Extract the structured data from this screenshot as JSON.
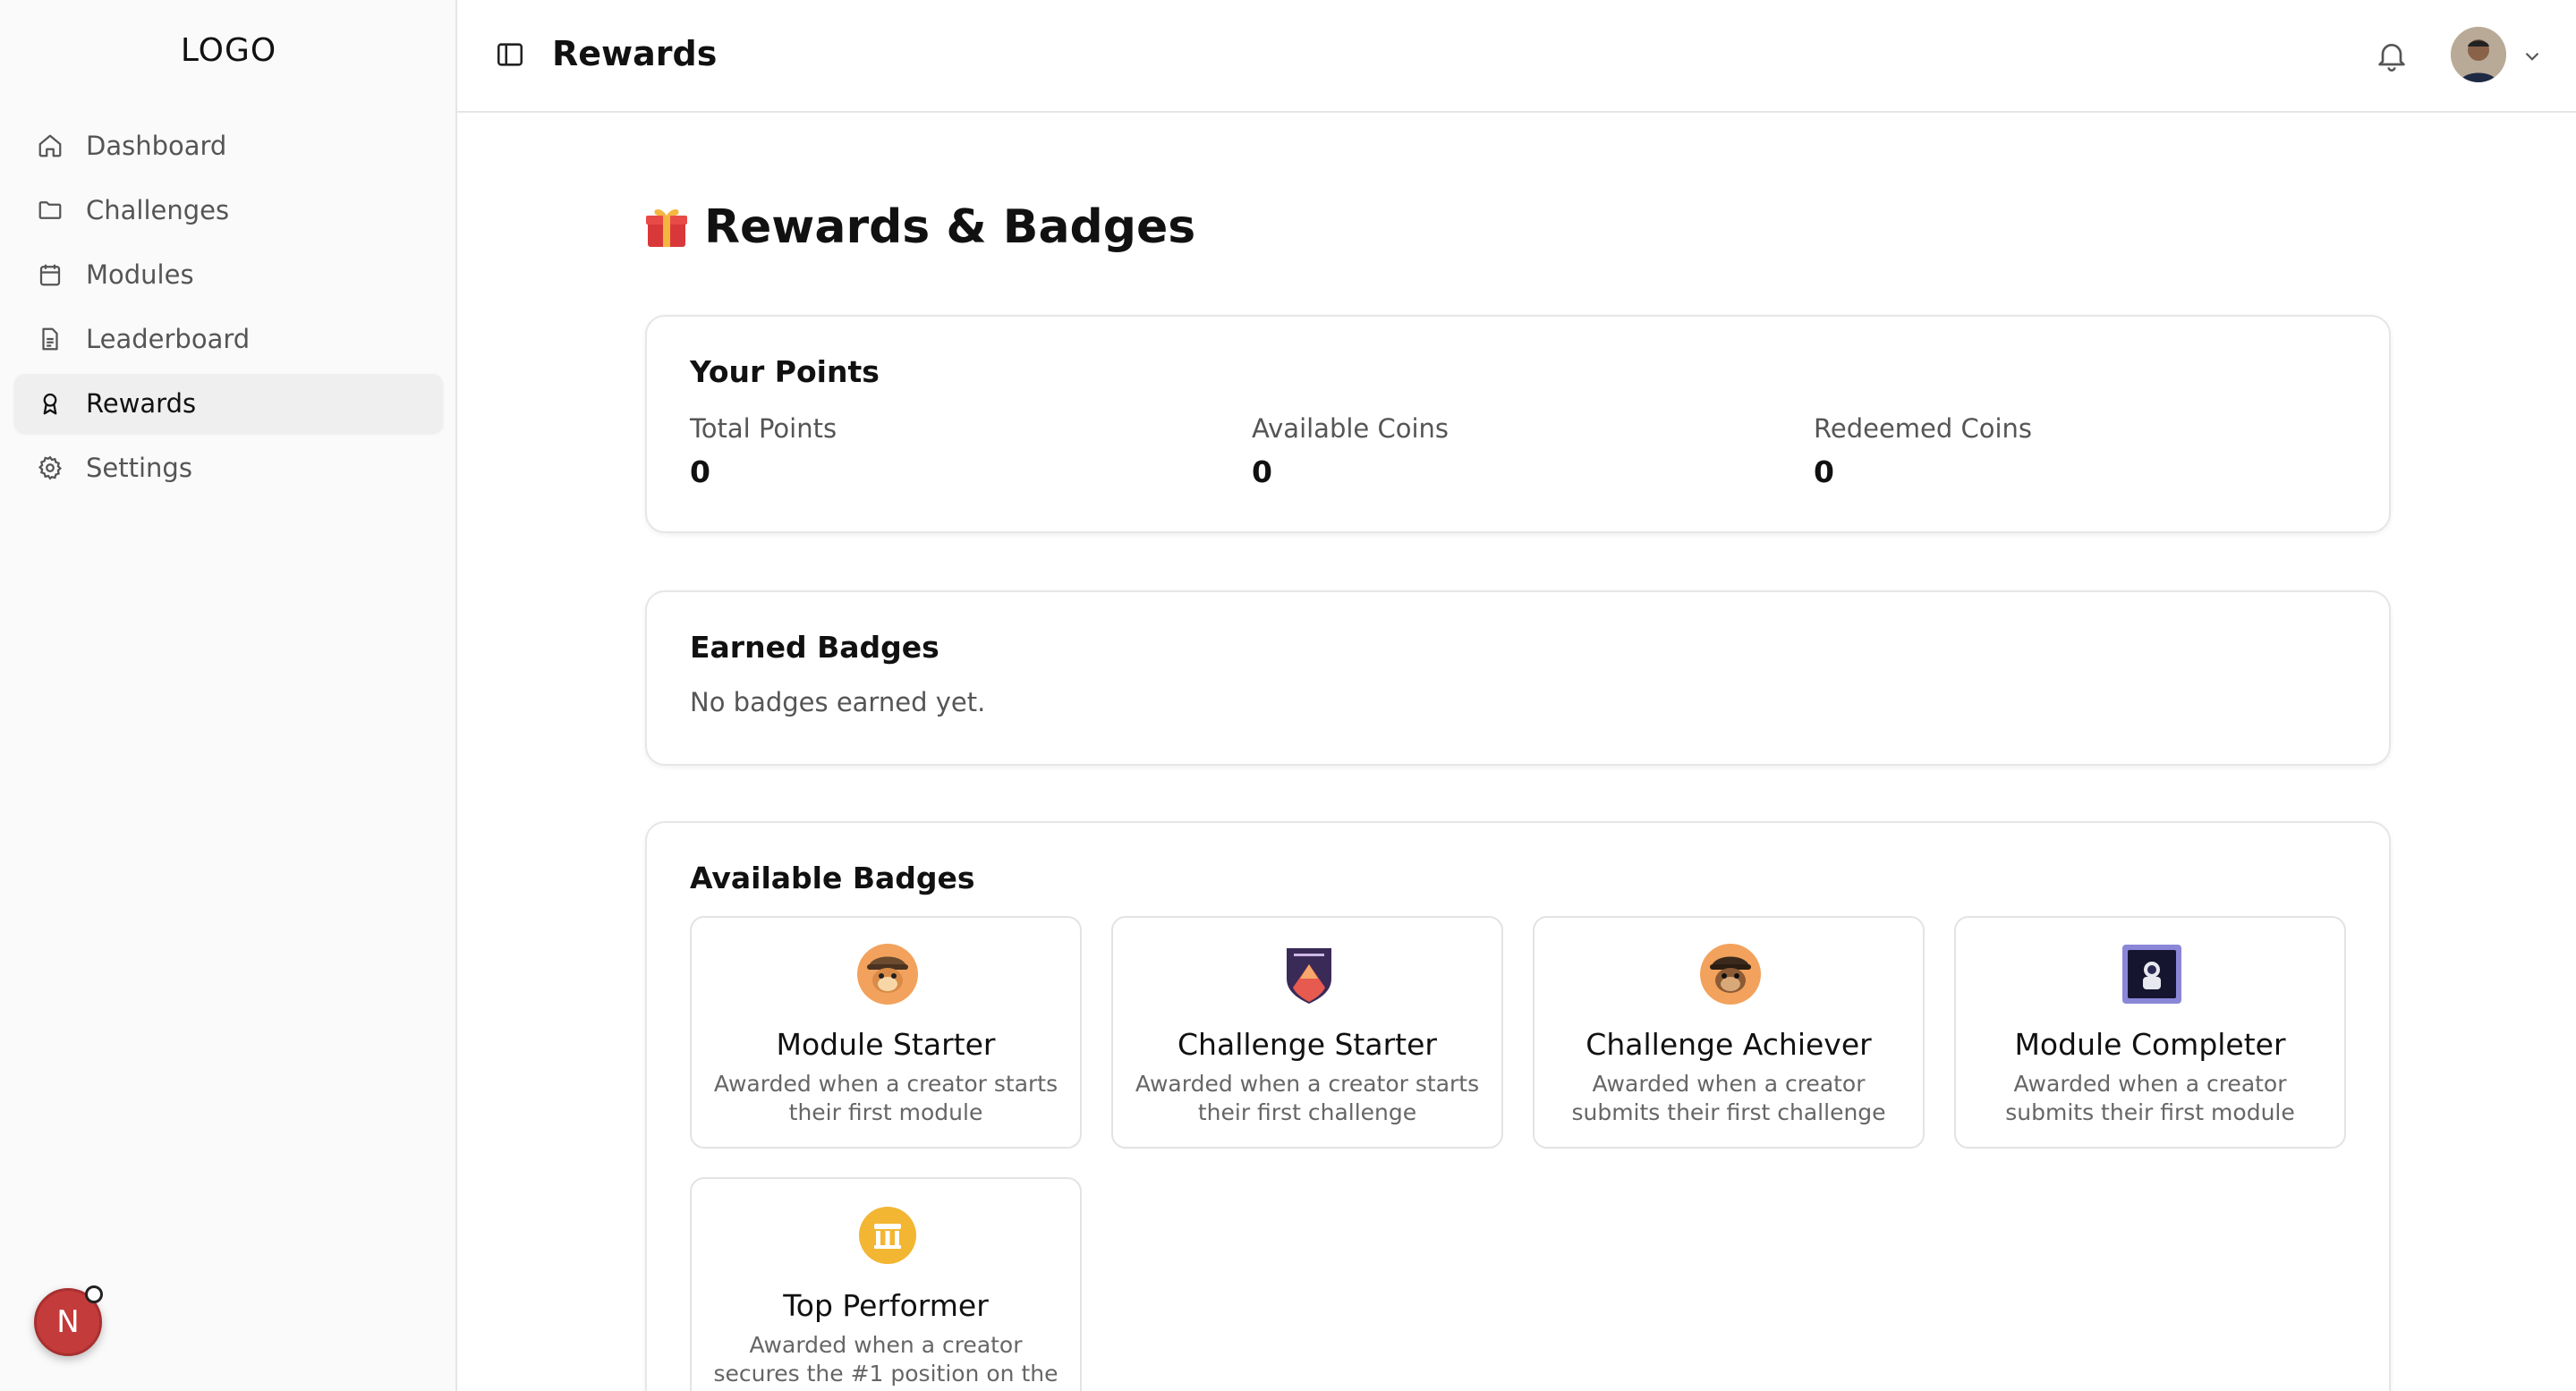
{
  "sidebar": {
    "logo": "LOGO",
    "items": [
      {
        "label": "Dashboard",
        "icon": "home-icon"
      },
      {
        "label": "Challenges",
        "icon": "folder-icon"
      },
      {
        "label": "Modules",
        "icon": "calendar-icon"
      },
      {
        "label": "Leaderboard",
        "icon": "document-icon"
      },
      {
        "label": "Rewards",
        "icon": "award-icon",
        "active": true
      },
      {
        "label": "Settings",
        "icon": "gear-icon"
      }
    ],
    "user_initial": "N"
  },
  "header": {
    "title": "Rewards"
  },
  "main": {
    "heading": "Rewards & Badges",
    "points": {
      "title": "Your Points",
      "total_label": "Total Points",
      "total_value": "0",
      "available_label": "Available Coins",
      "available_value": "0",
      "redeemed_label": "Redeemed Coins",
      "redeemed_value": "0"
    },
    "earned": {
      "title": "Earned Badges",
      "empty_text": "No badges earned yet."
    },
    "available": {
      "title": "Available Badges",
      "badges": [
        {
          "name": "Module Starter",
          "desc": "Awarded when a creator starts their first module",
          "icon": "monkey-badge-icon"
        },
        {
          "name": "Challenge Starter",
          "desc": "Awarded when a creator starts their first challenge",
          "icon": "shield-badge-icon"
        },
        {
          "name": "Challenge Achiever",
          "desc": "Awarded when a creator submits their first challenge",
          "icon": "monkey-badge-icon"
        },
        {
          "name": "Module Completer",
          "desc": "Awarded when a creator submits their first module",
          "icon": "astronaut-badge-icon"
        },
        {
          "name": "Top Performer",
          "desc": "Awarded when a creator secures the #1 position on the",
          "icon": "trophy-badge-icon"
        }
      ]
    }
  },
  "colors": {
    "accent_red": "#c43b3b",
    "gold": "#f2b632",
    "sidebar_bg": "#fafafa"
  }
}
